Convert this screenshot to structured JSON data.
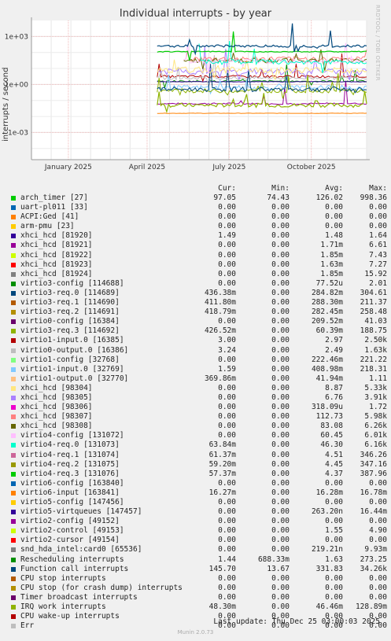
{
  "chart_data": {
    "type": "line",
    "title": "Individual interrupts - by year",
    "ylabel": "interrupts / second",
    "yscale": "log",
    "yticks": [
      {
        "v": 1000,
        "label": "1e+03"
      },
      {
        "v": 1,
        "label": "1e+00"
      },
      {
        "v": 0.001,
        "label": "1e-03"
      }
    ],
    "xticks": [
      {
        "t": 0.11,
        "label": "January 2025"
      },
      {
        "t": 0.345,
        "label": "April 2025"
      },
      {
        "t": 0.59,
        "label": "July 2025"
      },
      {
        "t": 0.835,
        "label": "October 2025"
      }
    ],
    "grid": true,
    "columns": [
      "Cur:",
      "Min:",
      "Avg:",
      "Max:"
    ],
    "series": [
      {
        "name": "arch_timer [27]",
        "color": "#00cc00",
        "cur": "97.05",
        "min": "74.43",
        "avg": "126.02",
        "max": "998.36"
      },
      {
        "name": "uart-pl011 [33]",
        "color": "#0066b3",
        "cur": "0.00",
        "min": "0.00",
        "avg": "0.00",
        "max": "0.00"
      },
      {
        "name": "ACPI:Ged [41]",
        "color": "#ff8000",
        "cur": "0.00",
        "min": "0.00",
        "avg": "0.00",
        "max": "0.00"
      },
      {
        "name": "arm-pmu [23]",
        "color": "#ffcc00",
        "cur": "0.00",
        "min": "0.00",
        "avg": "0.00",
        "max": "0.00"
      },
      {
        "name": "xhci_hcd [81920]",
        "color": "#330099",
        "cur": "1.49",
        "min": "0.00",
        "avg": "1.48",
        "max": "1.64"
      },
      {
        "name": "xhci_hcd [81921]",
        "color": "#990099",
        "cur": "0.00",
        "min": "0.00",
        "avg": "1.71m",
        "max": "6.61"
      },
      {
        "name": "xhci_hcd [81922]",
        "color": "#ccff00",
        "cur": "0.00",
        "min": "0.00",
        "avg": "1.85m",
        "max": "7.43"
      },
      {
        "name": "xhci_hcd [81923]",
        "color": "#ff0000",
        "cur": "0.00",
        "min": "0.00",
        "avg": "1.63m",
        "max": "7.27"
      },
      {
        "name": "xhci_hcd [81924]",
        "color": "#808080",
        "cur": "0.00",
        "min": "0.00",
        "avg": "1.85m",
        "max": "15.92"
      },
      {
        "name": "virtio3-config [114688]",
        "color": "#008f00",
        "cur": "0.00",
        "min": "0.00",
        "avg": "77.52u",
        "max": "2.01"
      },
      {
        "name": "virtio3-req.0 [114689]",
        "color": "#00487d",
        "cur": "436.38m",
        "min": "0.00",
        "avg": "284.82m",
        "max": "304.61"
      },
      {
        "name": "virtio3-req.1 [114690]",
        "color": "#b35a00",
        "cur": "411.80m",
        "min": "0.00",
        "avg": "288.30m",
        "max": "211.37"
      },
      {
        "name": "virtio3-req.2 [114691]",
        "color": "#b38f00",
        "cur": "418.79m",
        "min": "0.00",
        "avg": "282.45m",
        "max": "258.48"
      },
      {
        "name": "virtio0-config [16384]",
        "color": "#6b006b",
        "cur": "0.00",
        "min": "0.00",
        "avg": "209.52m",
        "max": "41.03"
      },
      {
        "name": "virtio3-req.3 [114692]",
        "color": "#8fb300",
        "cur": "426.52m",
        "min": "0.00",
        "avg": "60.39m",
        "max": "188.75"
      },
      {
        "name": "virtio1-input.0 [16385]",
        "color": "#b30000",
        "cur": "3.00",
        "min": "0.00",
        "avg": "2.97",
        "max": "2.50k"
      },
      {
        "name": "virtio0-output.0 [16386]",
        "color": "#bebebe",
        "cur": "3.24",
        "min": "0.00",
        "avg": "2.49",
        "max": "1.63k"
      },
      {
        "name": "virtio1-config [32768]",
        "color": "#80ff80",
        "cur": "0.00",
        "min": "0.00",
        "avg": "222.46m",
        "max": "221.22"
      },
      {
        "name": "virtio1-input.0 [32769]",
        "color": "#80c9ff",
        "cur": "1.59",
        "min": "0.00",
        "avg": "408.98m",
        "max": "218.31"
      },
      {
        "name": "virtio1-output.0 [32770]",
        "color": "#ffc080",
        "cur": "369.86m",
        "min": "0.00",
        "avg": "41.94m",
        "max": "1.11"
      },
      {
        "name": "xhci_hcd [98304]",
        "color": "#ffe680",
        "cur": "0.00",
        "min": "0.00",
        "avg": "8.87",
        "max": "5.33k"
      },
      {
        "name": "xhci_hcd [98305]",
        "color": "#aa80ff",
        "cur": "0.00",
        "min": "0.00",
        "avg": "6.76",
        "max": "3.91k"
      },
      {
        "name": "xhci_hcd [98306]",
        "color": "#ee00cc",
        "cur": "0.00",
        "min": "0.00",
        "avg": "318.09u",
        "max": "1.72"
      },
      {
        "name": "xhci_hcd [98307]",
        "color": "#ff8080",
        "cur": "0.00",
        "min": "0.00",
        "avg": "112.73",
        "max": "5.98k"
      },
      {
        "name": "xhci_hcd [98308]",
        "color": "#666600",
        "cur": "0.00",
        "min": "0.00",
        "avg": "83.08",
        "max": "6.26k"
      },
      {
        "name": "virtio4-config [131072]",
        "color": "#ffbfff",
        "cur": "0.00",
        "min": "0.00",
        "avg": "60.45",
        "max": "6.01k"
      },
      {
        "name": "virtio4-req.0 [131073]",
        "color": "#00ffcc",
        "cur": "63.84m",
        "min": "0.00",
        "avg": "46.30",
        "max": "6.16k"
      },
      {
        "name": "virtio4-req.1 [131074]",
        "color": "#cc6699",
        "cur": "61.37m",
        "min": "0.00",
        "avg": "4.51",
        "max": "346.26"
      },
      {
        "name": "virtio4-req.2 [131075]",
        "color": "#999900",
        "cur": "59.20m",
        "min": "0.00",
        "avg": "4.45",
        "max": "347.16"
      },
      {
        "name": "virtio4-req.3 [131076]",
        "color": "#00cc00",
        "cur": "57.37m",
        "min": "0.00",
        "avg": "4.37",
        "max": "387.96"
      },
      {
        "name": "virtio6-config [163840]",
        "color": "#0066b3",
        "cur": "0.00",
        "min": "0.00",
        "avg": "0.00",
        "max": "0.00"
      },
      {
        "name": "virtio6-input [163841]",
        "color": "#ff8000",
        "cur": "16.27m",
        "min": "0.00",
        "avg": "16.28m",
        "max": "16.78m"
      },
      {
        "name": "virtio5-config [147456]",
        "color": "#ffcc00",
        "cur": "0.00",
        "min": "0.00",
        "avg": "0.00",
        "max": "0.00"
      },
      {
        "name": "virtio5-virtqueues [147457]",
        "color": "#330099",
        "cur": "0.00",
        "min": "0.00",
        "avg": "263.20n",
        "max": "16.44m"
      },
      {
        "name": "virtio2-config [49152]",
        "color": "#990099",
        "cur": "0.00",
        "min": "0.00",
        "avg": "0.00",
        "max": "0.00"
      },
      {
        "name": "virtio2-control [49153]",
        "color": "#ccff00",
        "cur": "0.00",
        "min": "0.00",
        "avg": "1.55",
        "max": "4.90"
      },
      {
        "name": "virtio2-cursor [49154]",
        "color": "#ff0000",
        "cur": "0.00",
        "min": "0.00",
        "avg": "0.00",
        "max": "0.00"
      },
      {
        "name": "snd_hda_intel:card0 [65536]",
        "color": "#808080",
        "cur": "0.00",
        "min": "0.00",
        "avg": "219.21n",
        "max": "9.93m"
      },
      {
        "name": "Rescheduling interrupts",
        "color": "#008f00",
        "cur": "1.44",
        "min": "688.33m",
        "avg": "1.63",
        "max": "273.25"
      },
      {
        "name": "Function call interrupts",
        "color": "#00487d",
        "cur": "145.70",
        "min": "13.67",
        "avg": "331.83",
        "max": "34.26k"
      },
      {
        "name": "CPU stop interrupts",
        "color": "#b35a00",
        "cur": "0.00",
        "min": "0.00",
        "avg": "0.00",
        "max": "0.00"
      },
      {
        "name": "CPU stop (for crash dump) interrupts",
        "color": "#b38f00",
        "cur": "0.00",
        "min": "0.00",
        "avg": "0.00",
        "max": "0.00"
      },
      {
        "name": "Timer broadcast interrupts",
        "color": "#6b006b",
        "cur": "0.00",
        "min": "0.00",
        "avg": "0.00",
        "max": "0.00"
      },
      {
        "name": "IRQ work interrupts",
        "color": "#8fb300",
        "cur": "48.30m",
        "min": "0.00",
        "avg": "46.46m",
        "max": "128.89m"
      },
      {
        "name": "CPU wake-up interrupts",
        "color": "#b30000",
        "cur": "0.00",
        "min": "0.00",
        "avg": "0.00",
        "max": "0.00"
      },
      {
        "name": "Err",
        "color": "#bebebe",
        "cur": "0.00",
        "min": "0.00",
        "avg": "0.00",
        "max": "0.00"
      }
    ]
  },
  "footer": {
    "last_update": "Last update: Thu Dec 25 03:00:03 2025",
    "generator": "Munin 2.0.73",
    "side_tag": "RRDTOOL / TOBI OETIKER"
  }
}
